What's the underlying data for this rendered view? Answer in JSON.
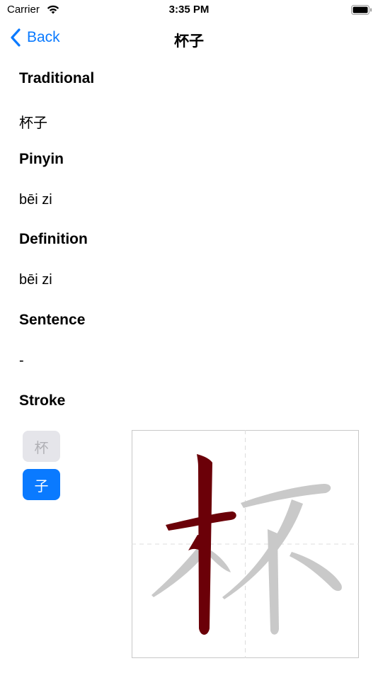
{
  "status_bar": {
    "carrier": "Carrier",
    "time": "3:35 PM",
    "wifi_icon": "wifi-icon",
    "battery_icon": "battery-icon"
  },
  "nav": {
    "back_label": "Back",
    "title": "杯子",
    "back_icon": "chevron-left-icon",
    "accent_color": "#0a7aff"
  },
  "sections": {
    "traditional": {
      "heading": "Traditional",
      "value": "杯子"
    },
    "pinyin": {
      "heading": "Pinyin",
      "value": "bēi zi"
    },
    "definition": {
      "heading": "Definition",
      "value": "bēi zi"
    },
    "sentence": {
      "heading": "Sentence",
      "value": "-"
    },
    "stroke": {
      "heading": "Stroke"
    }
  },
  "character_tiles": [
    {
      "char": "杯",
      "state": "inactive"
    },
    {
      "char": "子",
      "state": "selected"
    }
  ],
  "stroke_viewer": {
    "character": "杯",
    "highlight_color": "#6b0008",
    "ghost_color": "#c9c9c9"
  }
}
